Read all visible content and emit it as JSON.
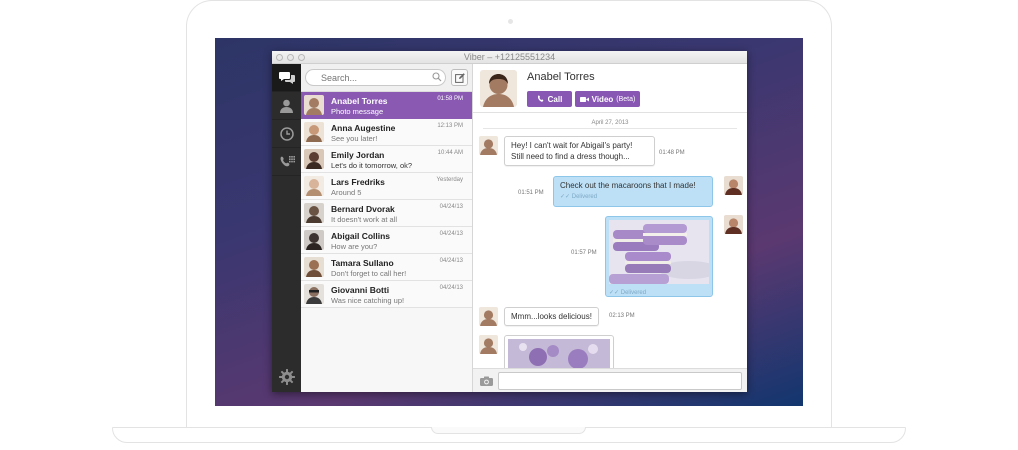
{
  "window": {
    "title": "Viber – +12125551234"
  },
  "search": {
    "placeholder": "Search..."
  },
  "conversations": [
    {
      "name": "Anabel Torres",
      "preview": "Photo message",
      "time": "01:58 PM",
      "active": true,
      "color": "#a27b62"
    },
    {
      "name": "Anna Augestine",
      "preview": "See you later!",
      "time": "12:13 PM",
      "color": "#c89978"
    },
    {
      "name": "Emily Jordan",
      "preview": "Let's do it tomorrow, ok?",
      "time": "10:44 AM",
      "color": "#5b3d31"
    },
    {
      "name": "Lars Fredriks",
      "preview": "Around 5",
      "time": "Yesterday",
      "color": "#d7b49a"
    },
    {
      "name": "Bernard Dvorak",
      "preview": "It doesn't work at all",
      "time": "04/24/13",
      "color": "#6b5343"
    },
    {
      "name": "Abigail Collins",
      "preview": "How are you?",
      "time": "04/24/13",
      "color": "#3d3431"
    },
    {
      "name": "Tamara Sullano",
      "preview": "Don't forget to call her!",
      "time": "04/24/13",
      "color": "#9a6f52"
    },
    {
      "name": "Giovanni Botti",
      "preview": "Was nice catching up!",
      "time": "04/24/13",
      "color": "#8a7060"
    }
  ],
  "chat": {
    "contact_name": "Anabel Torres",
    "call_label": "Call",
    "video_label": "Video",
    "video_beta": "(Beta)",
    "date": "April 27, 2013",
    "messages": {
      "m1_line1": "Hey! I can't wait for Abigail's party!",
      "m1_line2": "Still need to find a dress though...",
      "m1_time": "01:48 PM",
      "m2_text": "Check out the macaroons that I made!",
      "m2_status": "Delivered",
      "m2_time": "01:51 PM",
      "m3_status": "Delivered",
      "m3_time": "01:57 PM",
      "m4_text": "Mmm...looks delicious!",
      "m4_time": "02:13 PM"
    }
  },
  "colors": {
    "accent": "#8757b3",
    "active_row": "#8a5ab3",
    "outgoing_bubble": "#bde0f6"
  }
}
